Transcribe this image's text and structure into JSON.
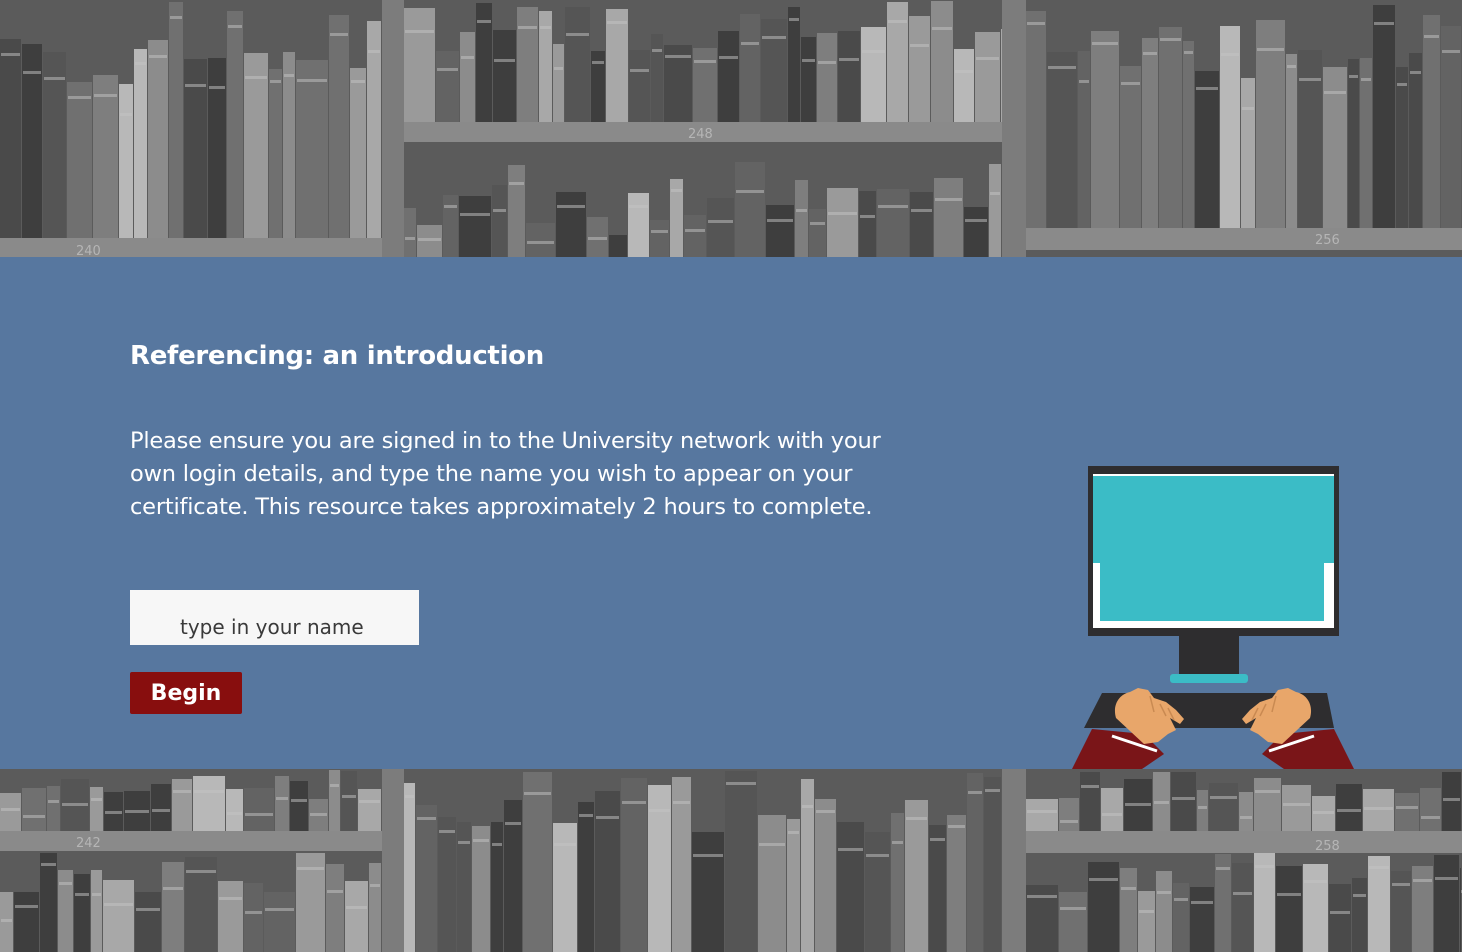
{
  "course": {
    "title": "Referencing: an introduction",
    "instructions": "Please ensure you are signed in to the University network with your own login details, and type the name you wish to appear on your certificate. This resource takes approximately 2 hours to complete."
  },
  "name_input": {
    "value": "",
    "placeholder": "type in your name"
  },
  "begin_button": {
    "label": "Begin"
  },
  "illustration": {
    "icon": "computer-user-icon"
  },
  "background": {
    "icon": "bookshelf-photo",
    "shelf_labels": {
      "top_left": "240",
      "top_middle": "248",
      "top_right": "256",
      "bottom_left": "242",
      "bottom_right": "258"
    }
  },
  "colors": {
    "panel": "#57779f",
    "button": "#880e0e",
    "monitor_screen": "#3bbcc6",
    "sleeve": "#7a1518",
    "skin": "#e8a66a"
  }
}
